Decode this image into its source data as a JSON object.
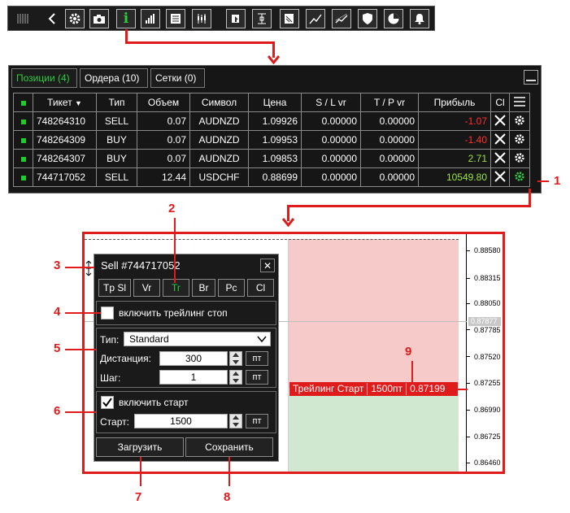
{
  "toolbar": {
    "icons": [
      "grip-icon",
      "back-arrow-icon",
      "gear-icon",
      "camera-icon",
      "info-icon",
      "bar-chart-icon",
      "list-icon",
      "candles-icon",
      "pin-icon",
      "ruler-icon",
      "document-icon",
      "trend-up-icon",
      "trend-line-icon",
      "shield-icon",
      "pie-icon",
      "bell-icon"
    ],
    "info_glyph": "i"
  },
  "tabs": [
    {
      "label": "Позиции (4)",
      "active": true
    },
    {
      "label": "Ордера (10)",
      "active": false
    },
    {
      "label": "Сетки (0)",
      "active": false
    }
  ],
  "table": {
    "headers": [
      "Тикет",
      "Тип",
      "Объем",
      "Символ",
      "Цена",
      "S / L vr",
      "T / P vr",
      "Прибыль",
      "Cl"
    ],
    "rows": [
      {
        "ticket": "748264310",
        "type": "SELL",
        "volume": "0.07",
        "symbol": "AUDNZD",
        "price": "1.09926",
        "sl": "0.00000",
        "tp": "0.00000",
        "profit": "-1.07"
      },
      {
        "ticket": "748264309",
        "type": "BUY",
        "volume": "0.07",
        "symbol": "AUDNZD",
        "price": "1.09953",
        "sl": "0.00000",
        "tp": "0.00000",
        "profit": "-1.40"
      },
      {
        "ticket": "748264307",
        "type": "BUY",
        "volume": "0.07",
        "symbol": "AUDNZD",
        "price": "1.09853",
        "sl": "0.00000",
        "tp": "0.00000",
        "profit": "2.71"
      },
      {
        "ticket": "744717052",
        "type": "SELL",
        "volume": "12.44",
        "symbol": "USDCHF",
        "price": "0.88699",
        "sl": "0.00000",
        "tp": "0.00000",
        "profit": "10549.80"
      }
    ]
  },
  "price_axis": {
    "labels": [
      "0.88580",
      "0.88315",
      "0.88050",
      "0.87785",
      "0.87520",
      "0.87255",
      "0.86990",
      "0.86725",
      "0.86460"
    ],
    "current": "0.87877"
  },
  "trailing_label": {
    "name": "Трейлинг Старт",
    "distance": "1500пт",
    "price": "0.87199"
  },
  "dialog": {
    "title": "Sell  #744717052",
    "close_glyph": "✕",
    "tabs": [
      "Tp Sl",
      "Vr",
      "Tr",
      "Br",
      "Pc",
      "Cl"
    ],
    "active_tab": "Tr",
    "enable_trailing_label": "включить трейлинг стоп",
    "type_label": "Тип:",
    "type_value": "Standard",
    "distance_label": "Дистанция:",
    "distance_value": "300",
    "step_label": "Шаг:",
    "step_value": "1",
    "unit": "пт",
    "enable_start_label": "включить старт",
    "start_checked": true,
    "start_label": "Старт:",
    "start_value": "1500",
    "load_button": "Загрузить",
    "save_button": "Сохранить"
  },
  "annotations": [
    "1",
    "2",
    "3",
    "4",
    "5",
    "6",
    "7",
    "8",
    "9"
  ],
  "colors": {
    "accent_green": "#2ecc40",
    "annotation_red": "#e01b1b",
    "loss_red": "#ff3030",
    "profit_green": "#9be33c"
  }
}
